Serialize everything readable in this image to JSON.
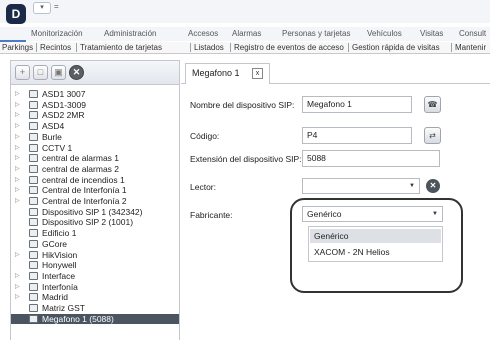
{
  "title_bar": {
    "logo": "D",
    "qat_icon": "save-icon",
    "qat_more": "="
  },
  "menu": [
    "Monitorización",
    "Administración",
    "Accesos",
    "Alarmas",
    "Personas y tarjetas",
    "Vehículos",
    "Visitas",
    "Consult"
  ],
  "toolbar": [
    "Parkings",
    "Recintos",
    "Tratamiento de tarjetas",
    "Listados",
    "Registro de eventos de acceso",
    "Gestion rápida de visitas",
    "Mantenir"
  ],
  "left_toolbar": {
    "buttons": [
      "+",
      "□",
      "▣",
      "✕"
    ]
  },
  "tree": [
    {
      "label": "ASD1 3007",
      "icon": "reader-icon",
      "expandable": true
    },
    {
      "label": "ASD1-3009",
      "icon": "reader-icon",
      "expandable": true
    },
    {
      "label": "ASD2 2MR",
      "icon": "reader-icon",
      "expandable": true
    },
    {
      "label": "ASD4",
      "icon": "reader-icon",
      "expandable": true
    },
    {
      "label": "Burle",
      "icon": "controller-icon",
      "expandable": true
    },
    {
      "label": "CCTV 1",
      "icon": "camera-icon",
      "expandable": true
    },
    {
      "label": "central de alarmas 1",
      "icon": "alarm-panel-icon",
      "expandable": true
    },
    {
      "label": "central de alarmas 2",
      "icon": "alarm-panel-icon",
      "expandable": true
    },
    {
      "label": "central de incendios 1",
      "icon": "fire-panel-icon",
      "expandable": true
    },
    {
      "label": "Central de Interfonía 1",
      "icon": "intercom-icon",
      "expandable": true
    },
    {
      "label": "Central de Interfonía 2",
      "icon": "intercom-icon",
      "expandable": true
    },
    {
      "label": "Dispositivo SIP 1 (342342)",
      "icon": "sip-icon",
      "expandable": false
    },
    {
      "label": "Dispositivo SIP 2 (1001)",
      "icon": "sip-icon",
      "expandable": false
    },
    {
      "label": "Edificio 1",
      "icon": "building-icon",
      "expandable": false
    },
    {
      "label": "GCore",
      "icon": "controller-icon",
      "expandable": false
    },
    {
      "label": "HikVision",
      "icon": "camera-icon",
      "expandable": true
    },
    {
      "label": "Honywell",
      "icon": "controller-icon",
      "expandable": false
    },
    {
      "label": "Interface",
      "icon": "interface-icon",
      "expandable": true
    },
    {
      "label": "Interfonía",
      "icon": "intercom-icon",
      "expandable": true
    },
    {
      "label": "Madrid",
      "icon": "building-icon",
      "expandable": true
    },
    {
      "label": "Matriz GST",
      "icon": "controller-icon",
      "expandable": false
    },
    {
      "label": "Megafono 1 (5088)",
      "icon": "megaphone-icon",
      "expandable": false,
      "selected": true
    }
  ],
  "tab": {
    "label": "Megafono 1",
    "close": "x"
  },
  "form": {
    "sip_name_label": "Nombre del dispositivo SIP:",
    "sip_name_value": "Megafono 1",
    "code_label": "Código:",
    "code_value": "P4",
    "ext_label": "Extensión del dispositivo SIP:",
    "ext_value": "5088",
    "reader_label": "Lector:",
    "reader_value": "",
    "maker_label": "Fabricante:",
    "maker_value": "Genérico",
    "maker_options": [
      "Genérico",
      "XACOM - 2N Helios"
    ]
  },
  "colors": {
    "accent": "#4a7cc4",
    "selected_row": "#4b5561"
  }
}
